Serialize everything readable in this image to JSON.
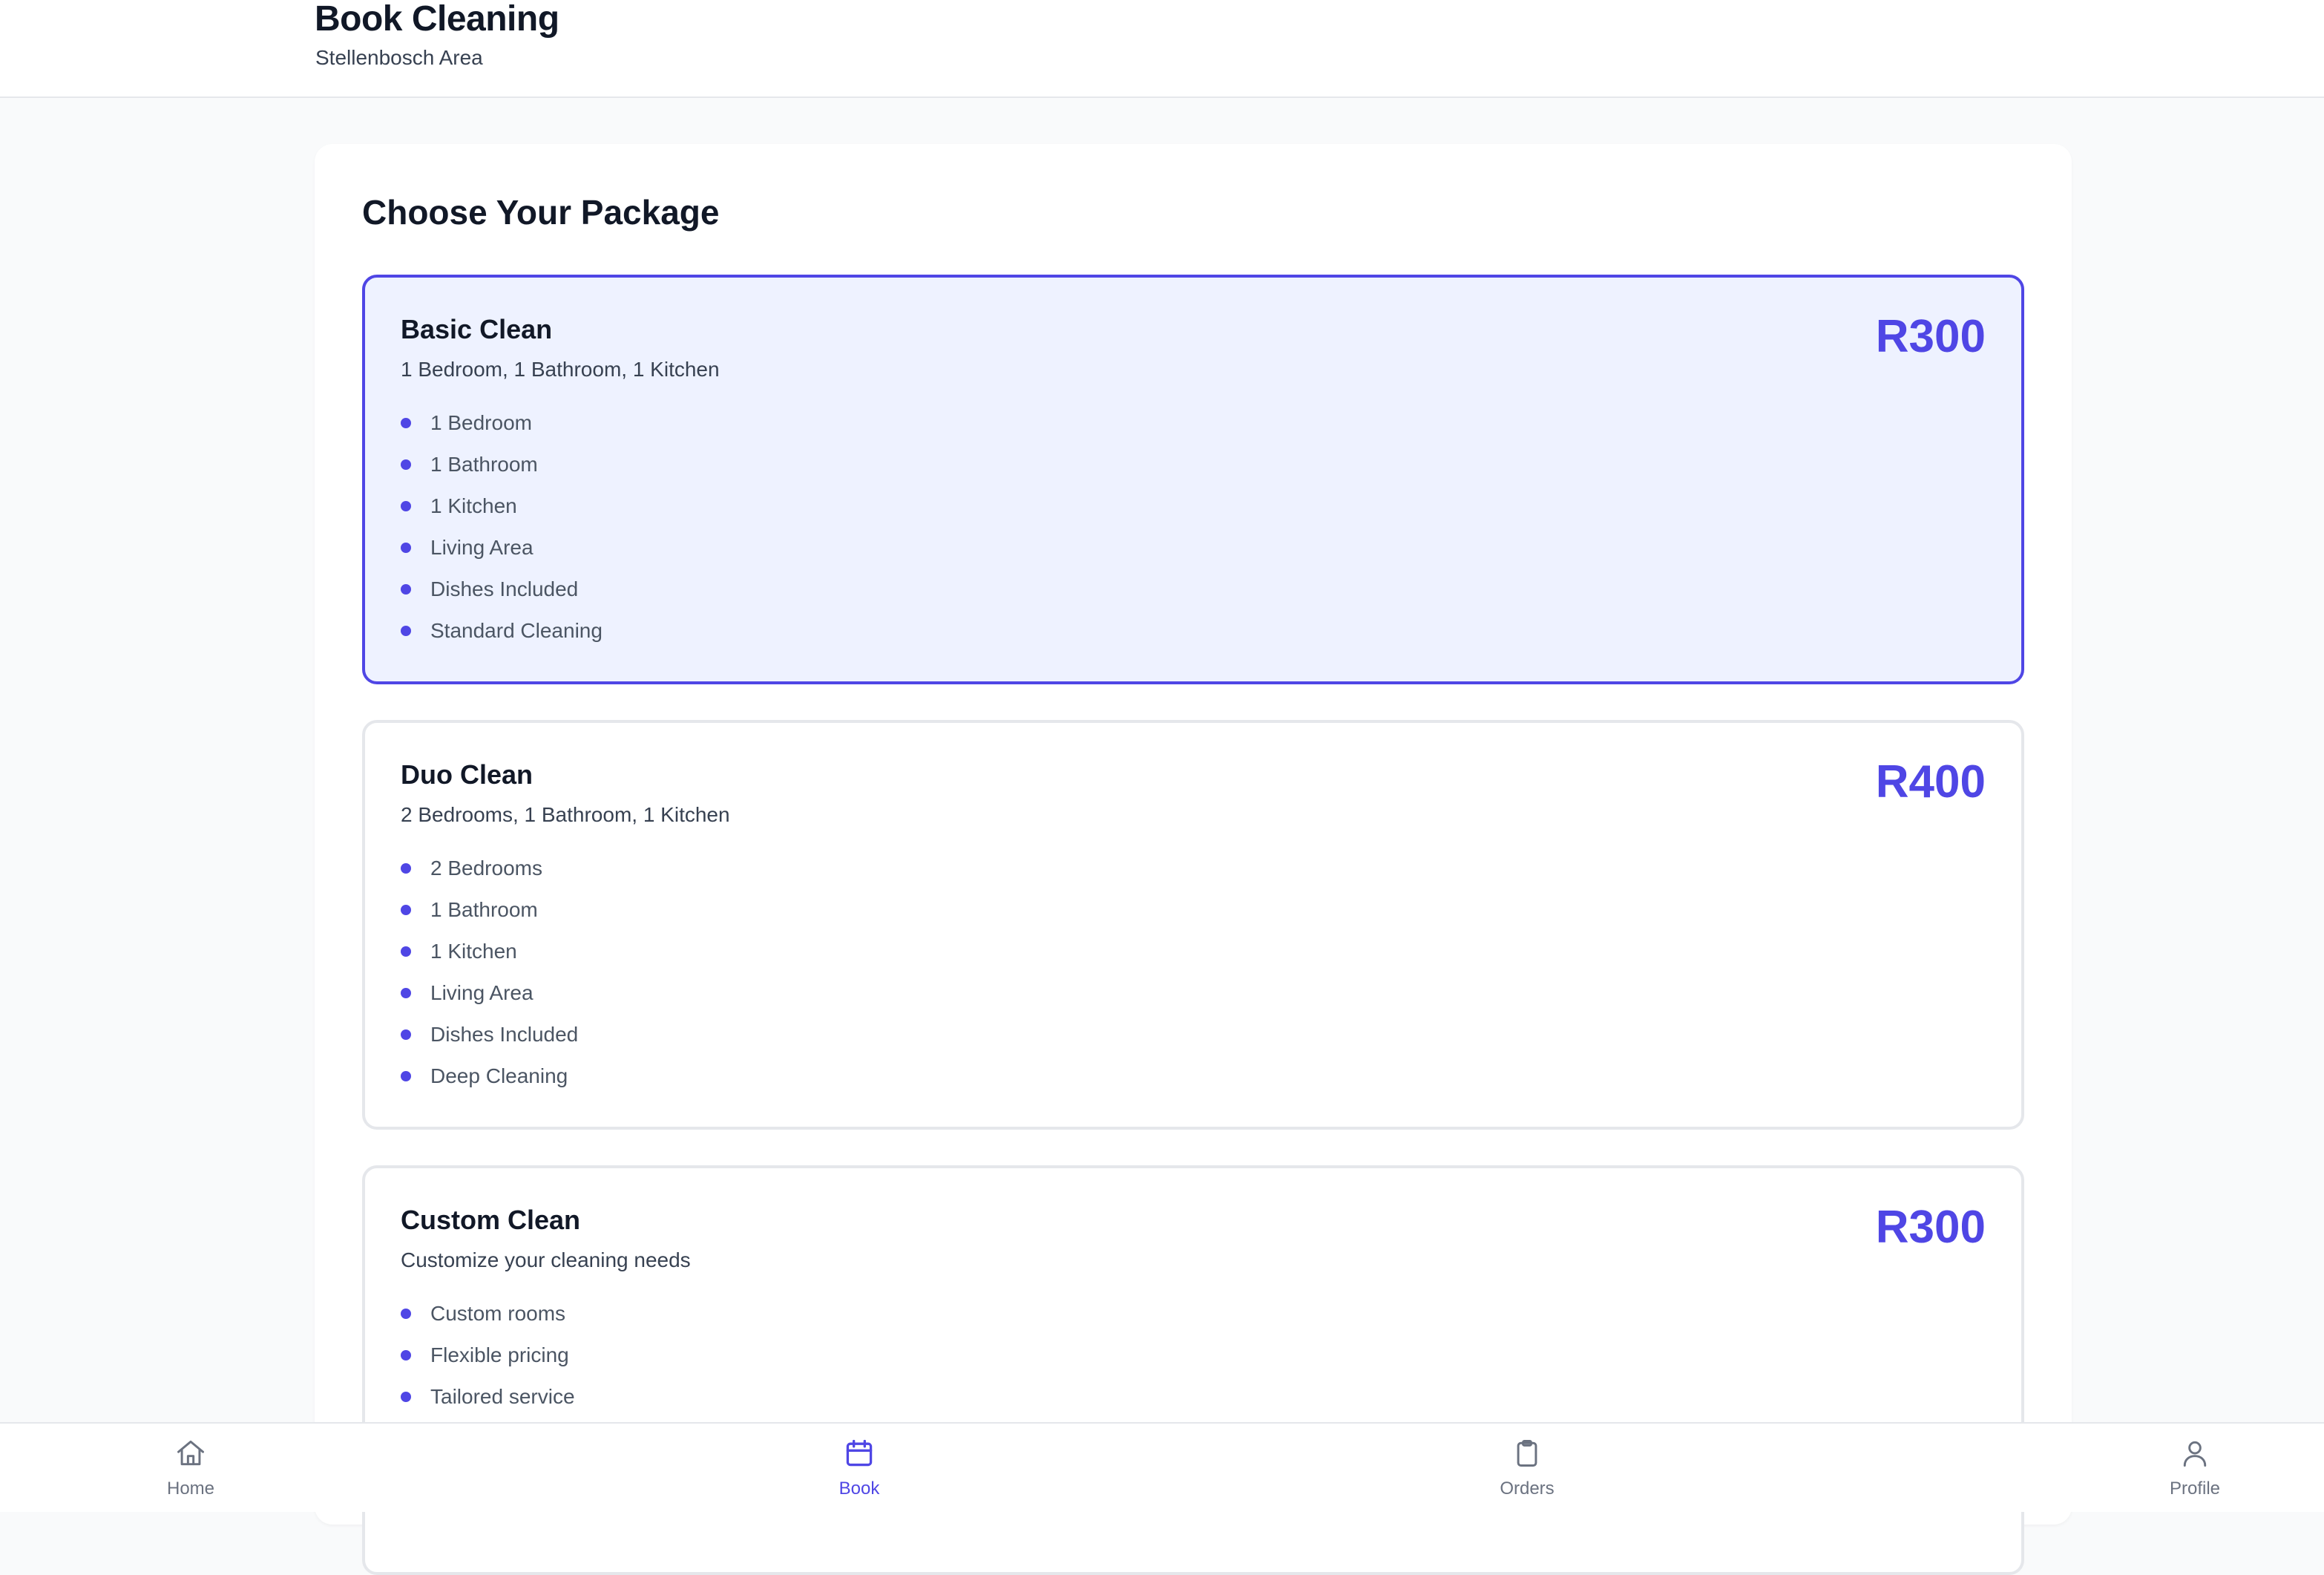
{
  "header": {
    "title": "Book Cleaning",
    "subtitle": "Stellenbosch Area"
  },
  "main": {
    "title": "Choose Your Package",
    "packages": [
      {
        "name": "Basic Clean",
        "description": "1 Bedroom, 1 Bathroom, 1 Kitchen",
        "price": "R300",
        "selected": true,
        "features": [
          "1 Bedroom",
          "1 Bathroom",
          "1 Kitchen",
          "Living Area",
          "Dishes Included",
          "Standard Cleaning"
        ]
      },
      {
        "name": "Duo Clean",
        "description": "2 Bedrooms, 1 Bathroom, 1 Kitchen",
        "price": "R400",
        "selected": false,
        "features": [
          "2 Bedrooms",
          "1 Bathroom",
          "1 Kitchen",
          "Living Area",
          "Dishes Included",
          "Deep Cleaning"
        ]
      },
      {
        "name": "Custom Clean",
        "description": "Customize your cleaning needs",
        "price": "R300",
        "selected": false,
        "features": [
          "Custom rooms",
          "Flexible pricing",
          "Tailored service"
        ]
      }
    ]
  },
  "nav": {
    "items": [
      {
        "label": "Home",
        "icon": "home-icon",
        "active": false
      },
      {
        "label": "Book",
        "icon": "calendar-icon",
        "active": true
      },
      {
        "label": "Orders",
        "icon": "clipboard-icon",
        "active": false
      },
      {
        "label": "Profile",
        "icon": "user-icon",
        "active": false
      }
    ]
  },
  "colors": {
    "accent": "#4f46e5",
    "selected_bg": "#eef2ff",
    "border": "#e5e7eb",
    "page_bg": "#f9fafb",
    "muted_text": "#6b7280"
  }
}
